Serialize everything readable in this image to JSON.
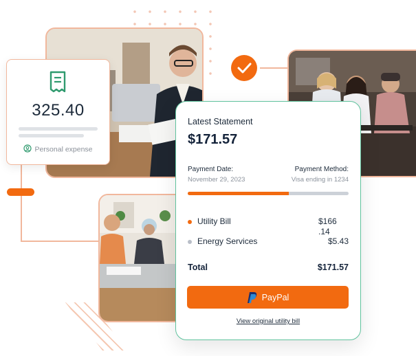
{
  "expense_card": {
    "amount": "325.40",
    "tag_label": "Personal expense",
    "icon": "receipt-icon",
    "tag_icon": "user-circle-icon"
  },
  "statement": {
    "title": "Latest Statement",
    "total": "$171.57",
    "payment_date_label": "Payment Date:",
    "payment_date_value": "November 29, 2023",
    "payment_method_label": "Payment Method:",
    "payment_method_value": "Visa ending in 1234",
    "progress_fraction": 0.63,
    "items": [
      {
        "label": "Utility Bill",
        "amount_line1": "$166",
        "amount_line2": ".14",
        "bullet_color": "#f26a10"
      },
      {
        "label": "Energy Services",
        "amount": "$5.43",
        "bullet_color": "#b9bec8"
      }
    ],
    "total_label": "Total",
    "total_value": "$171.57",
    "paypal_label": "PayPal",
    "link_label": "View original utility bill"
  },
  "colors": {
    "accent": "#f26a10",
    "card_border": "#5fc29d",
    "peach": "#f1b79c"
  }
}
